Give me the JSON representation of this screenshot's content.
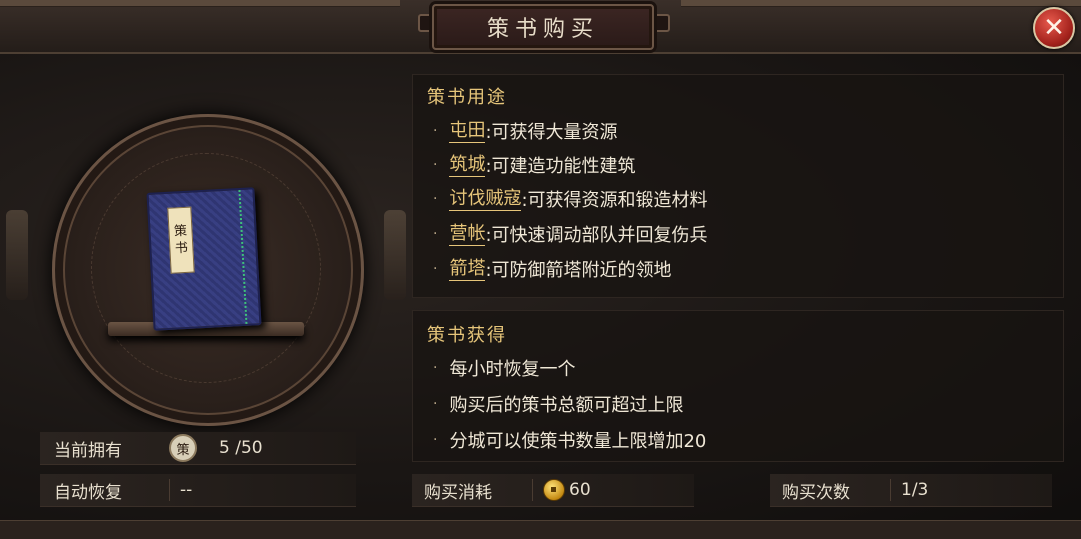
{
  "window": {
    "title": "策书购买",
    "close_symbol": "✕"
  },
  "book": {
    "label_chars": [
      "策",
      "书"
    ]
  },
  "left_info": {
    "owned": {
      "label": "当前拥有",
      "badge": "策",
      "value": "5 /50"
    },
    "auto_recover": {
      "label": "自动恢复",
      "value": "--"
    }
  },
  "usage": {
    "title": "策书用途",
    "items": [
      {
        "keyword": "屯田",
        "desc": ":可获得大量资源"
      },
      {
        "keyword": "筑城",
        "desc": ":可建造功能性建筑"
      },
      {
        "keyword": "讨伐贼寇",
        "desc": ":可获得资源和锻造材料"
      },
      {
        "keyword": "营帐",
        "desc": ":可快速调动部队并回复伤兵"
      },
      {
        "keyword": "箭塔",
        "desc": ":可防御箭塔附近的领地"
      }
    ]
  },
  "gain": {
    "title": "策书获得",
    "items": [
      "每小时恢复一个",
      "购买后的策书总额可超过上限",
      "分城可以使策书数量上限增加20"
    ]
  },
  "purchase": {
    "cost_label": "购买消耗",
    "cost_value": "60",
    "count_label": "购买次数",
    "count_value": "1/3"
  },
  "colors": {
    "accent_gold": "#e6c57a",
    "close_red": "#c0302a"
  }
}
